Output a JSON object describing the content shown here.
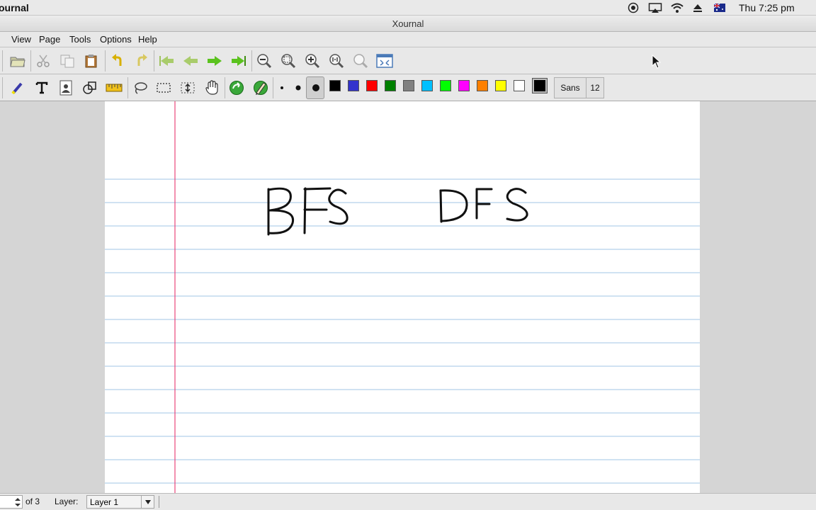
{
  "menubar": {
    "app_name": "ournal",
    "clock": "Thu 7:25 pm",
    "icons": [
      "record-icon",
      "airplay-icon",
      "wifi-icon",
      "eject-icon",
      "flag-icon"
    ]
  },
  "window": {
    "title": "Xournal"
  },
  "app_menu": [
    "View",
    "Page",
    "Tools",
    "Options",
    "Help"
  ],
  "toolbar_main": {
    "buttons": [
      "open-icon",
      "cut-icon",
      "copy-icon",
      "paste-icon",
      "undo-icon",
      "redo-icon",
      "first-page-icon",
      "prev-page-icon",
      "next-page-icon",
      "last-page-icon",
      "zoom-out-icon",
      "zoom-page-width-icon",
      "zoom-in-icon",
      "zoom-normal-icon",
      "zoom-set-icon",
      "fullscreen-icon"
    ]
  },
  "toolbar_tools": {
    "tools": [
      "highlighter-icon",
      "text-icon",
      "image-icon",
      "shape-recognizer-icon",
      "ruler-icon",
      "lasso-icon",
      "rect-select-icon",
      "vertical-space-icon",
      "hand-icon",
      "default-pen-icon",
      "pen-settings-icon"
    ],
    "thickness": [
      "thin",
      "medium",
      "thick"
    ],
    "colors": [
      "#000000",
      "#3333cc",
      "#ff0000",
      "#008000",
      "#808080",
      "#00c0ff",
      "#00ff00",
      "#ff00ff",
      "#ff8000",
      "#ffff00",
      "#ffffff",
      "#000000"
    ],
    "font_name": "Sans",
    "font_size": "12"
  },
  "page": {
    "handwriting": [
      "BFS",
      "DFS"
    ],
    "ruling_color": "#a0c4e6",
    "margin_color": "#e8457a"
  },
  "statusbar": {
    "page_of": "of 3",
    "layer_label": "Layer:",
    "layer_value": "Layer 1"
  }
}
